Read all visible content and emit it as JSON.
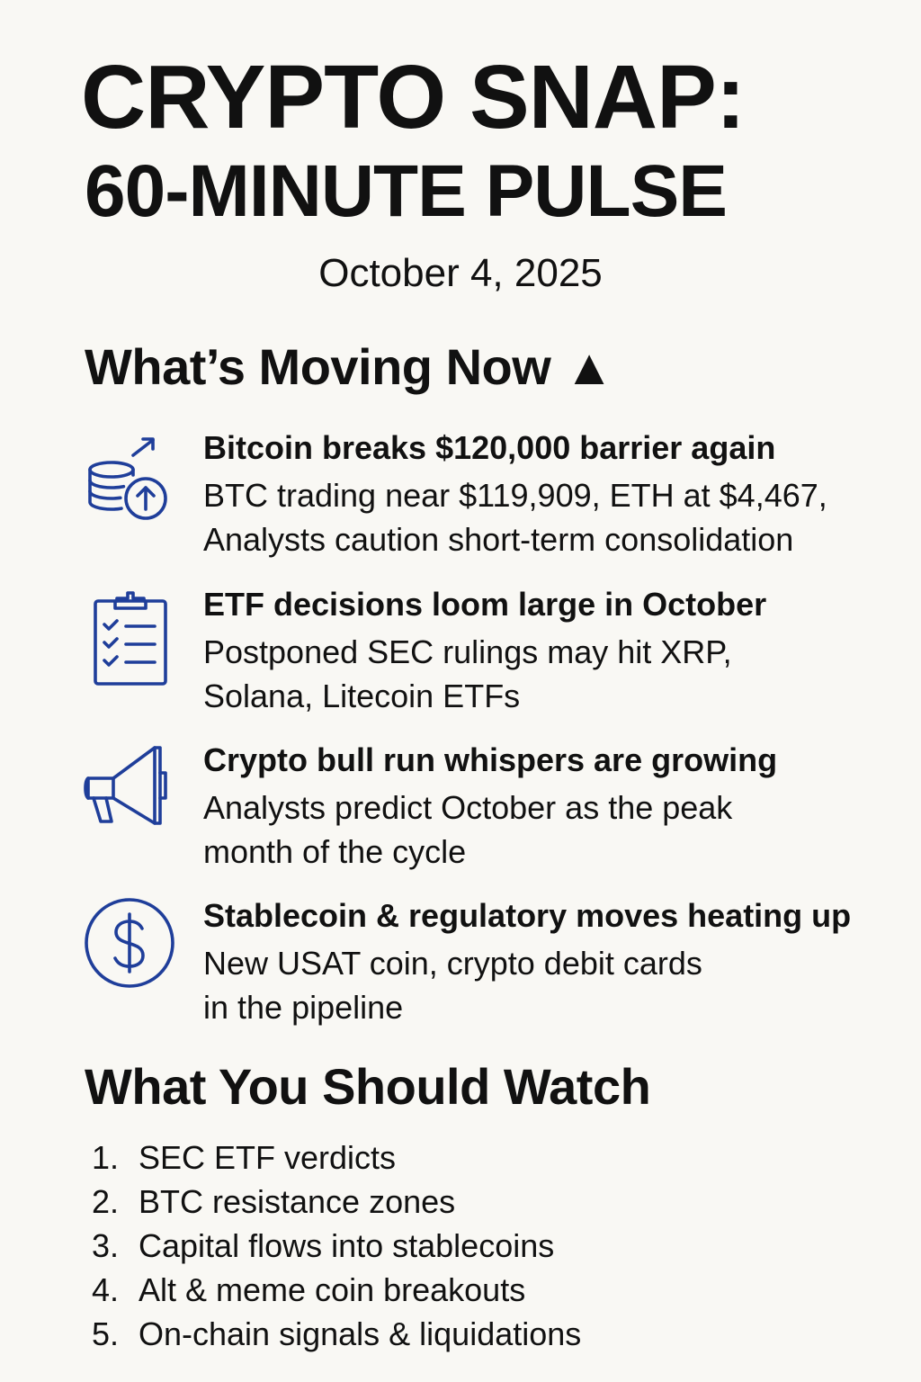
{
  "header": {
    "title_line1": "CRYPTO SNAP:",
    "title_line2": "60-MINUTE PULSE",
    "date": "October 4, 2025"
  },
  "moving": {
    "heading": "What’s Moving Now ▲",
    "accent_color": "#1f3e9a",
    "items": [
      {
        "icon": "coins-up-icon",
        "headline": "Bitcoin breaks $120,000 barrier again",
        "line1": "BTC trading near $119,909, ETH at $4,467,",
        "line2": "Analysts caution short-term consolidation"
      },
      {
        "icon": "clipboard-checklist-icon",
        "headline": "ETF decisions loom large in October",
        "line1": "Postponed SEC rulings may hit XRP,",
        "line2": "Solana, Litecoin ETFs"
      },
      {
        "icon": "megaphone-icon",
        "headline": "Crypto bull run whispers are growing",
        "line1": "Analysts predict October as the peak",
        "line2": "month of the cycle"
      },
      {
        "icon": "dollar-circle-icon",
        "headline": "Stablecoin & regulatory moves heating up",
        "line1": "New USAT coin, crypto debit cards",
        "line2": "in the pipeline"
      }
    ]
  },
  "watch": {
    "heading": "What You Should Watch",
    "items": [
      {
        "num": "1.",
        "text": "SEC ETF verdicts"
      },
      {
        "num": "2.",
        "text": "BTC resistance zones"
      },
      {
        "num": "3.",
        "text": "Capital flows into stablecoins"
      },
      {
        "num": "4.",
        "text": "Alt & meme coin breakouts"
      },
      {
        "num": "5.",
        "text": "On-chain signals & liquidations"
      }
    ]
  }
}
